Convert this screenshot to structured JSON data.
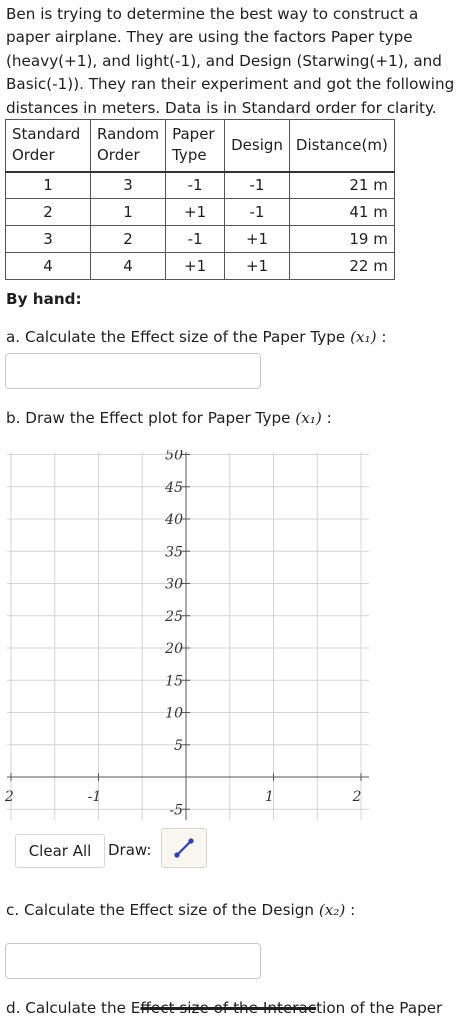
{
  "intro": {
    "line1": "Ben is trying to determine the best way to construct a",
    "line2": "paper airplane. They are using the factors Paper type",
    "line3": "(heavy(+1), and light(-1), and Design (Starwing(+1), and",
    "line4": "Basic(-1)). They ran their experiment and got the following",
    "line5": "distances in meters. Data is in Standard order for clarity."
  },
  "table": {
    "headers": {
      "std_l1": "Standard",
      "std_l2": "Order",
      "rand_l1": "Random",
      "rand_l2": "Order",
      "paper_l1": "Paper",
      "paper_l2": "Type",
      "design": "Design",
      "distance": "Distance(m)"
    },
    "rows": [
      {
        "std": "1",
        "rand": "3",
        "paper": "-1",
        "design": "-1",
        "dist": "21 m"
      },
      {
        "std": "2",
        "rand": "1",
        "paper": "+1",
        "design": "-1",
        "dist": "41 m"
      },
      {
        "std": "3",
        "rand": "2",
        "paper": "-1",
        "design": "+1",
        "dist": "19 m"
      },
      {
        "std": "4",
        "rand": "4",
        "paper": "+1",
        "design": "+1",
        "dist": "22 m"
      }
    ]
  },
  "by_hand": "By hand:",
  "question_a": {
    "text": "a. Calculate the Effect size of the Paper Type ",
    "var": "(x₁)",
    "suffix": " :"
  },
  "question_b": {
    "text": "b. Draw the Effect plot for Paper Type ",
    "var": "(x₁)",
    "suffix": " :"
  },
  "question_c": {
    "text": "c. Calculate the Effect size of the Design ",
    "var": "(x₂)",
    "suffix": " :"
  },
  "question_d": {
    "pre": "d. Calculate the E",
    "struck": "ffect size of the Interac",
    "post": "tion of the Paper"
  },
  "plot": {
    "x_ticks": [
      "-2",
      "-1",
      "1",
      "2"
    ],
    "y_ticks": [
      "50",
      "45",
      "40",
      "35",
      "30",
      "25",
      "20",
      "15",
      "10",
      "5",
      "-5"
    ]
  },
  "buttons": {
    "clear_all": "Clear All",
    "draw_label": "Draw:"
  },
  "draw_tool_icon": "line-pen-icon",
  "draw_tool_color": "#2a3fbf"
}
